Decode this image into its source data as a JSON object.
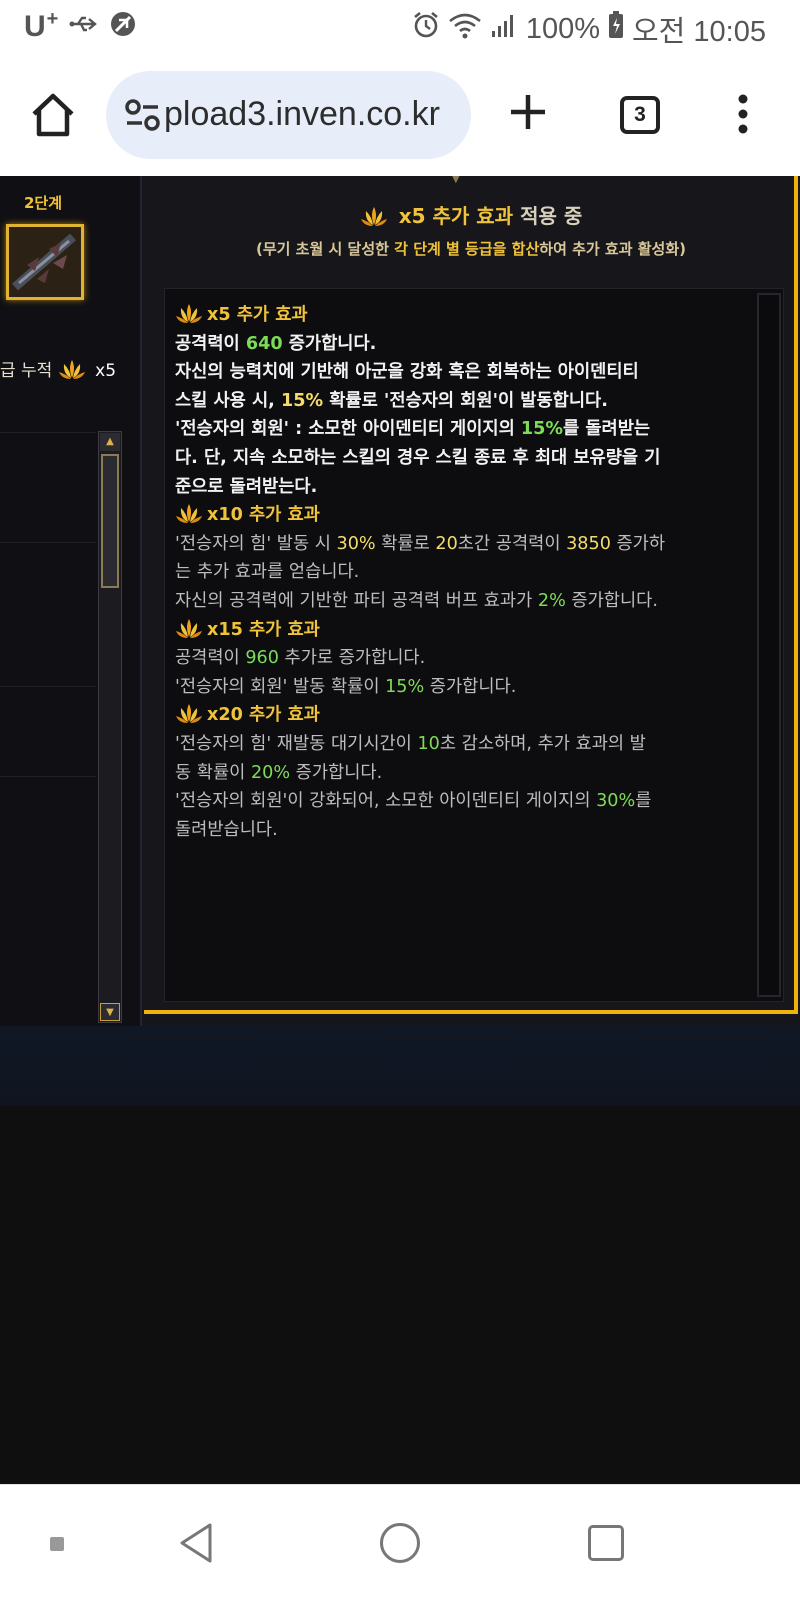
{
  "status_bar": {
    "carrier": "U",
    "carrier_sup": "+",
    "battery": "100%",
    "time": "오전 10:05"
  },
  "browser": {
    "url": "pload3.inven.co.kr",
    "tab_count": "3"
  },
  "game": {
    "stage_label": "2단계",
    "stack_label": "급 누적",
    "stack_count": "x5",
    "header_count": "x5",
    "header_rest": "추가 효과",
    "header_tail": "적용 중",
    "sub_a": "(무기 초월 시 달성한",
    "sub_hl": "각 단계 별 등급을 합산",
    "sub_b": "하여 추가 효과 활성화)",
    "effects": {
      "h5": "x5 추가 효과",
      "l1a": "공격력이 ",
      "l1v": "640",
      "l1b": " 증가합니다.",
      "l2": "자신의 능력치에 기반해 아군을 강화 혹은 회복하는 아이덴티티",
      "l3a": "스킬 사용 시, ",
      "l3v": "15%",
      "l3b": " 확률로 '전승자의 회원'이 발동합니다.",
      "l4a": "'전승자의 회원' : 소모한 아이덴티티 게이지의 ",
      "l4v": "15%",
      "l4b": "를 돌려받는",
      "l5": "다. 단, 지속 소모하는 스킬의 경우 스킬 종료 후 최대 보유량을 기",
      "l6": "준으로 돌려받는다.",
      "h10": "x10 추가 효과",
      "l7a": "'전승자의 힘' 발동 시 ",
      "l7v1": "30%",
      "l7b": " 확률로 ",
      "l7v2": "20",
      "l7c": "초간 공격력이 ",
      "l7v3": "3850",
      "l7d": " 증가하",
      "l8": "는 추가 효과를 얻습니다.",
      "l9a": "자신의 공격력에 기반한 파티 공격력 버프 효과가 ",
      "l9v": "2%",
      "l9b": " 증가합니다.",
      "h15": "x15 추가 효과",
      "l10a": "공격력이 ",
      "l10v": "960",
      "l10b": " 추가로 증가합니다.",
      "l11a": "'전승자의 회원' 발동 확률이 ",
      "l11v": "15%",
      "l11b": " 증가합니다.",
      "h20": "x20 추가 효과",
      "l12a": "'전승자의 힘' 재발동 대기시간이 ",
      "l12v": "10",
      "l12b": "초 감소하며, 추가 효과의 발",
      "l13a": "동 확률이 ",
      "l13v": "20%",
      "l13b": " 증가합니다.",
      "l14a": "'전승자의 회원'이 강화되어, 소모한 아이덴티티 게이지의 ",
      "l14v": "30%",
      "l14b": "를",
      "l15": "돌려받습니다."
    }
  },
  "colors": {
    "gold": "#f0c33a",
    "green": "#7ddc57",
    "frame": "#f0b20a"
  },
  "icons": [
    "usb-icon",
    "data-saver-icon",
    "alarm-icon",
    "wifi-icon",
    "signal-icon",
    "battery-icon",
    "home-icon",
    "site-settings-icon",
    "plus-icon",
    "tabs-icon",
    "more-icon",
    "lotus-icon",
    "nav-back-icon",
    "nav-home-icon",
    "nav-recent-icon"
  ]
}
